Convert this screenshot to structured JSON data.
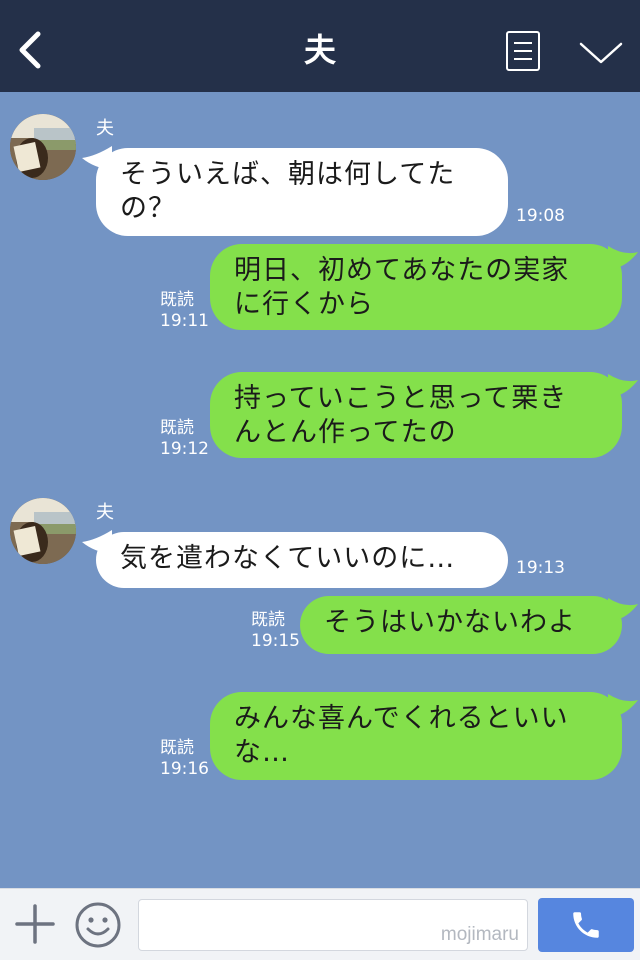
{
  "header": {
    "title": "夫",
    "back_icon": "chevron-left-icon",
    "menu_icon": "list-menu-icon",
    "collapse_icon": "chevron-down-icon"
  },
  "messages": [
    {
      "from": "夫",
      "side": "left",
      "lines": [
        "そういえば、朝は何してた",
        "の？"
      ],
      "time": "19:08"
    },
    {
      "side": "right",
      "status": "既読",
      "lines": [
        "明日、初めてあなたの実家",
        "に行くから"
      ],
      "time": "19:11"
    },
    {
      "side": "right",
      "status": "既読",
      "lines": [
        "持っていこうと思って栗き",
        "んとん作ってたの"
      ],
      "time": "19:12"
    },
    {
      "from": "夫",
      "side": "left",
      "lines": [
        "気を遣わなくていいのに…"
      ],
      "time": "19:13"
    },
    {
      "side": "right",
      "status": "既読",
      "lines": [
        "そうはいかないわよ"
      ],
      "time": "19:15"
    },
    {
      "side": "right",
      "status": "既読",
      "lines": [
        "みんな喜んでくれるといい",
        "な…"
      ],
      "time": "19:16"
    }
  ],
  "footer": {
    "input_placeholder": "",
    "watermark": "mojimaru",
    "plus_icon": "plus-icon",
    "emoji_icon": "smiley-icon",
    "call_icon": "phone-icon"
  },
  "colors": {
    "header_bg": "#243049",
    "chat_bg": "#7394c4",
    "bubble_sent": "#84e04b",
    "bubble_received": "#ffffff",
    "call_button": "#5686df"
  }
}
